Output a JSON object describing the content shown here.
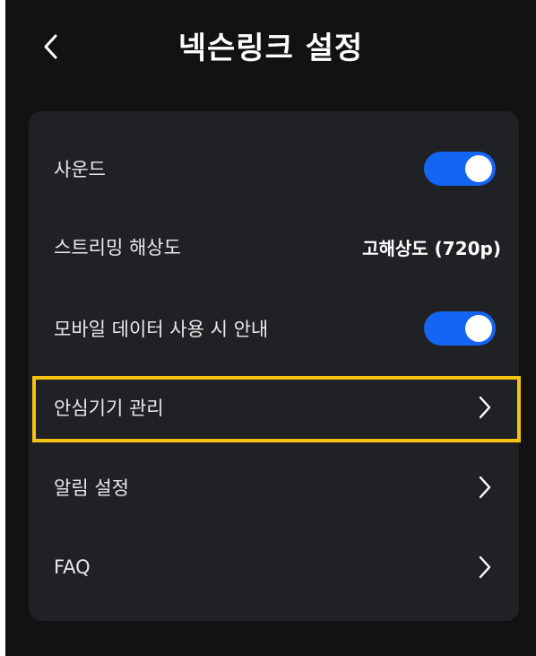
{
  "header": {
    "title": "넥슨링크 설정",
    "back_icon": "chevron-left-icon"
  },
  "settings": {
    "sound": {
      "label": "사운드",
      "enabled": true
    },
    "streaming_resolution": {
      "label": "스트리밍 해상도",
      "value": "고해상도 (720p)"
    },
    "mobile_data_notice": {
      "label": "모바일 데이터 사용 시 안내",
      "enabled": true
    },
    "trusted_devices": {
      "label": "안심기기 관리",
      "icon": "chevron-right-icon",
      "highlighted": true
    },
    "notification_settings": {
      "label": "알림 설정",
      "icon": "chevron-right-icon"
    },
    "faq": {
      "label": "FAQ",
      "icon": "chevron-right-icon"
    }
  },
  "colors": {
    "background": "#121212",
    "card": "#202124",
    "toggle_on": "#1565f5",
    "highlight": "#f5c211",
    "text": "#e9e9e9"
  }
}
